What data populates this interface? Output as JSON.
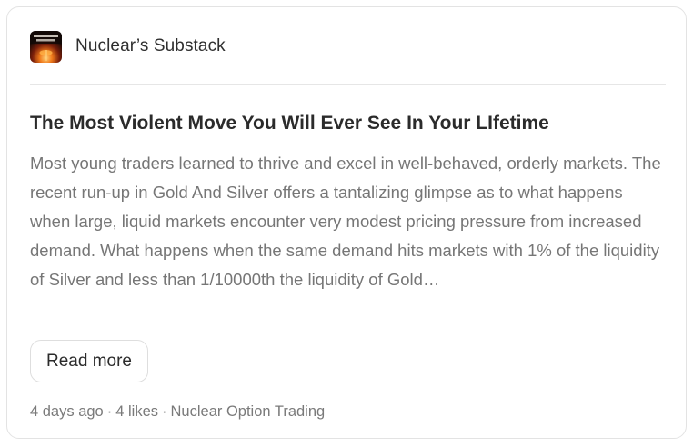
{
  "publication": {
    "name": "Nuclear’s Substack",
    "logo_icon": "nuclear-option-logo",
    "logo_text": "NUCLEAR OPTION"
  },
  "post": {
    "title": "The Most Violent Move You Will Ever See In Your LIfetime",
    "excerpt": "Most young traders learned to thrive and excel in well-behaved, orderly markets. The recent run-up in Gold And Silver offers a tantalizing glimpse as to what happens when large, liquid markets encounter very modest pricing pressure from increased demand. What happens when the same demand hits markets with 1% of the liquidity of Silver and less than 1/10000th the liquidity of Gold…",
    "read_more_label": "Read more"
  },
  "meta": {
    "time_ago": "4 days ago",
    "likes": "4 likes",
    "author": "Nuclear Option Trading",
    "separator": "·"
  },
  "colors": {
    "title": "#2b2b2b",
    "excerpt": "#767676",
    "meta": "#7a7a7a",
    "border": "#e3e3e3"
  }
}
